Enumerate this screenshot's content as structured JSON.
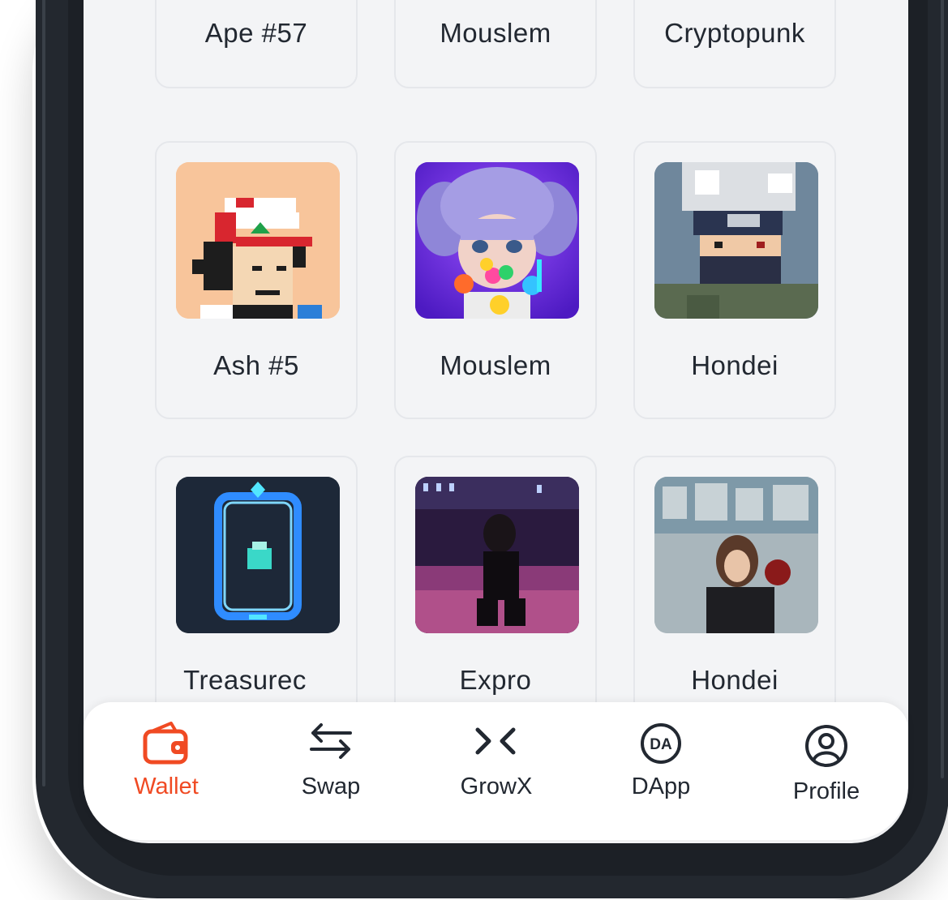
{
  "grid": {
    "top_row": [
      {
        "label": "Ape #57"
      },
      {
        "label": "Mouslem"
      },
      {
        "label": "Cryptopunk"
      }
    ],
    "middle_row": [
      {
        "label": "Ash #5"
      },
      {
        "label": "Mouslem"
      },
      {
        "label": "Hondei"
      }
    ],
    "bottom_row": [
      {
        "label": "Treasurec"
      },
      {
        "label": "Expro"
      },
      {
        "label": "Hondei"
      }
    ]
  },
  "nav": {
    "items": [
      {
        "label": "Wallet",
        "icon": "wallet-icon",
        "active": true
      },
      {
        "label": "Swap",
        "icon": "swap-arrows-icon",
        "active": false
      },
      {
        "label": "GrowX",
        "icon": "growx-icon",
        "active": false
      },
      {
        "label": "DApp",
        "icon": "dapp-icon",
        "active": false,
        "icon_text": "DA"
      },
      {
        "label": "Profile",
        "icon": "profile-icon",
        "active": false
      }
    ]
  },
  "colors": {
    "accent": "#f04a23",
    "screen_bg": "#f3f4f6",
    "frame": "#23282f",
    "text": "#222831"
  }
}
